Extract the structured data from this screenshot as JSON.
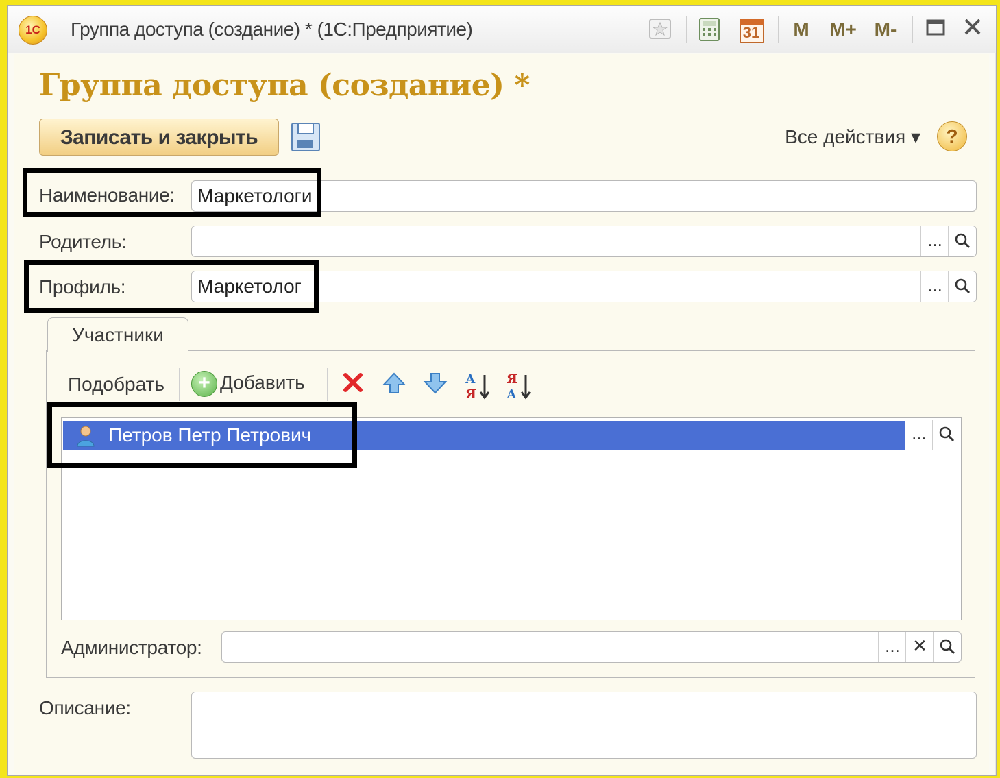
{
  "window": {
    "logo_text": "1С",
    "title": "Группа доступа (создание) * (1С:Предприятие)",
    "toolbar": {
      "favorites_icon": "star-icon",
      "calculator_icon": "calculator-icon",
      "calendar_label": "31",
      "m_label": "M",
      "m_plus_label": "M+",
      "m_minus_label": "M-",
      "maximize_icon": "maximize-icon",
      "close_icon": "close-icon"
    }
  },
  "form": {
    "title": "Группа доступа (создание) *",
    "save_close_label": "Записать и закрыть",
    "all_actions_label": "Все действия ▾",
    "help_label": "?"
  },
  "fields": {
    "name": {
      "label": "Наименование:",
      "value": "Маркетологи"
    },
    "parent": {
      "label": "Родитель:",
      "value": ""
    },
    "profile": {
      "label": "Профиль:",
      "value": "Маркетолог"
    },
    "administrator": {
      "label": "Администратор:",
      "value": ""
    },
    "description": {
      "label": "Описание:",
      "value": ""
    }
  },
  "participants": {
    "tab_label": "Участники",
    "pick_label": "Подобрать",
    "add_label": "Добавить",
    "rows": [
      {
        "name": "Петров Петр Петрович",
        "selected": true
      }
    ]
  },
  "button_glyphs": {
    "ellipsis": "...",
    "search": "🔍",
    "clear": "✕"
  },
  "colors": {
    "title_accent": "#c8921a",
    "selection": "#4a6fd4",
    "background_outer": "#f4e51a"
  }
}
